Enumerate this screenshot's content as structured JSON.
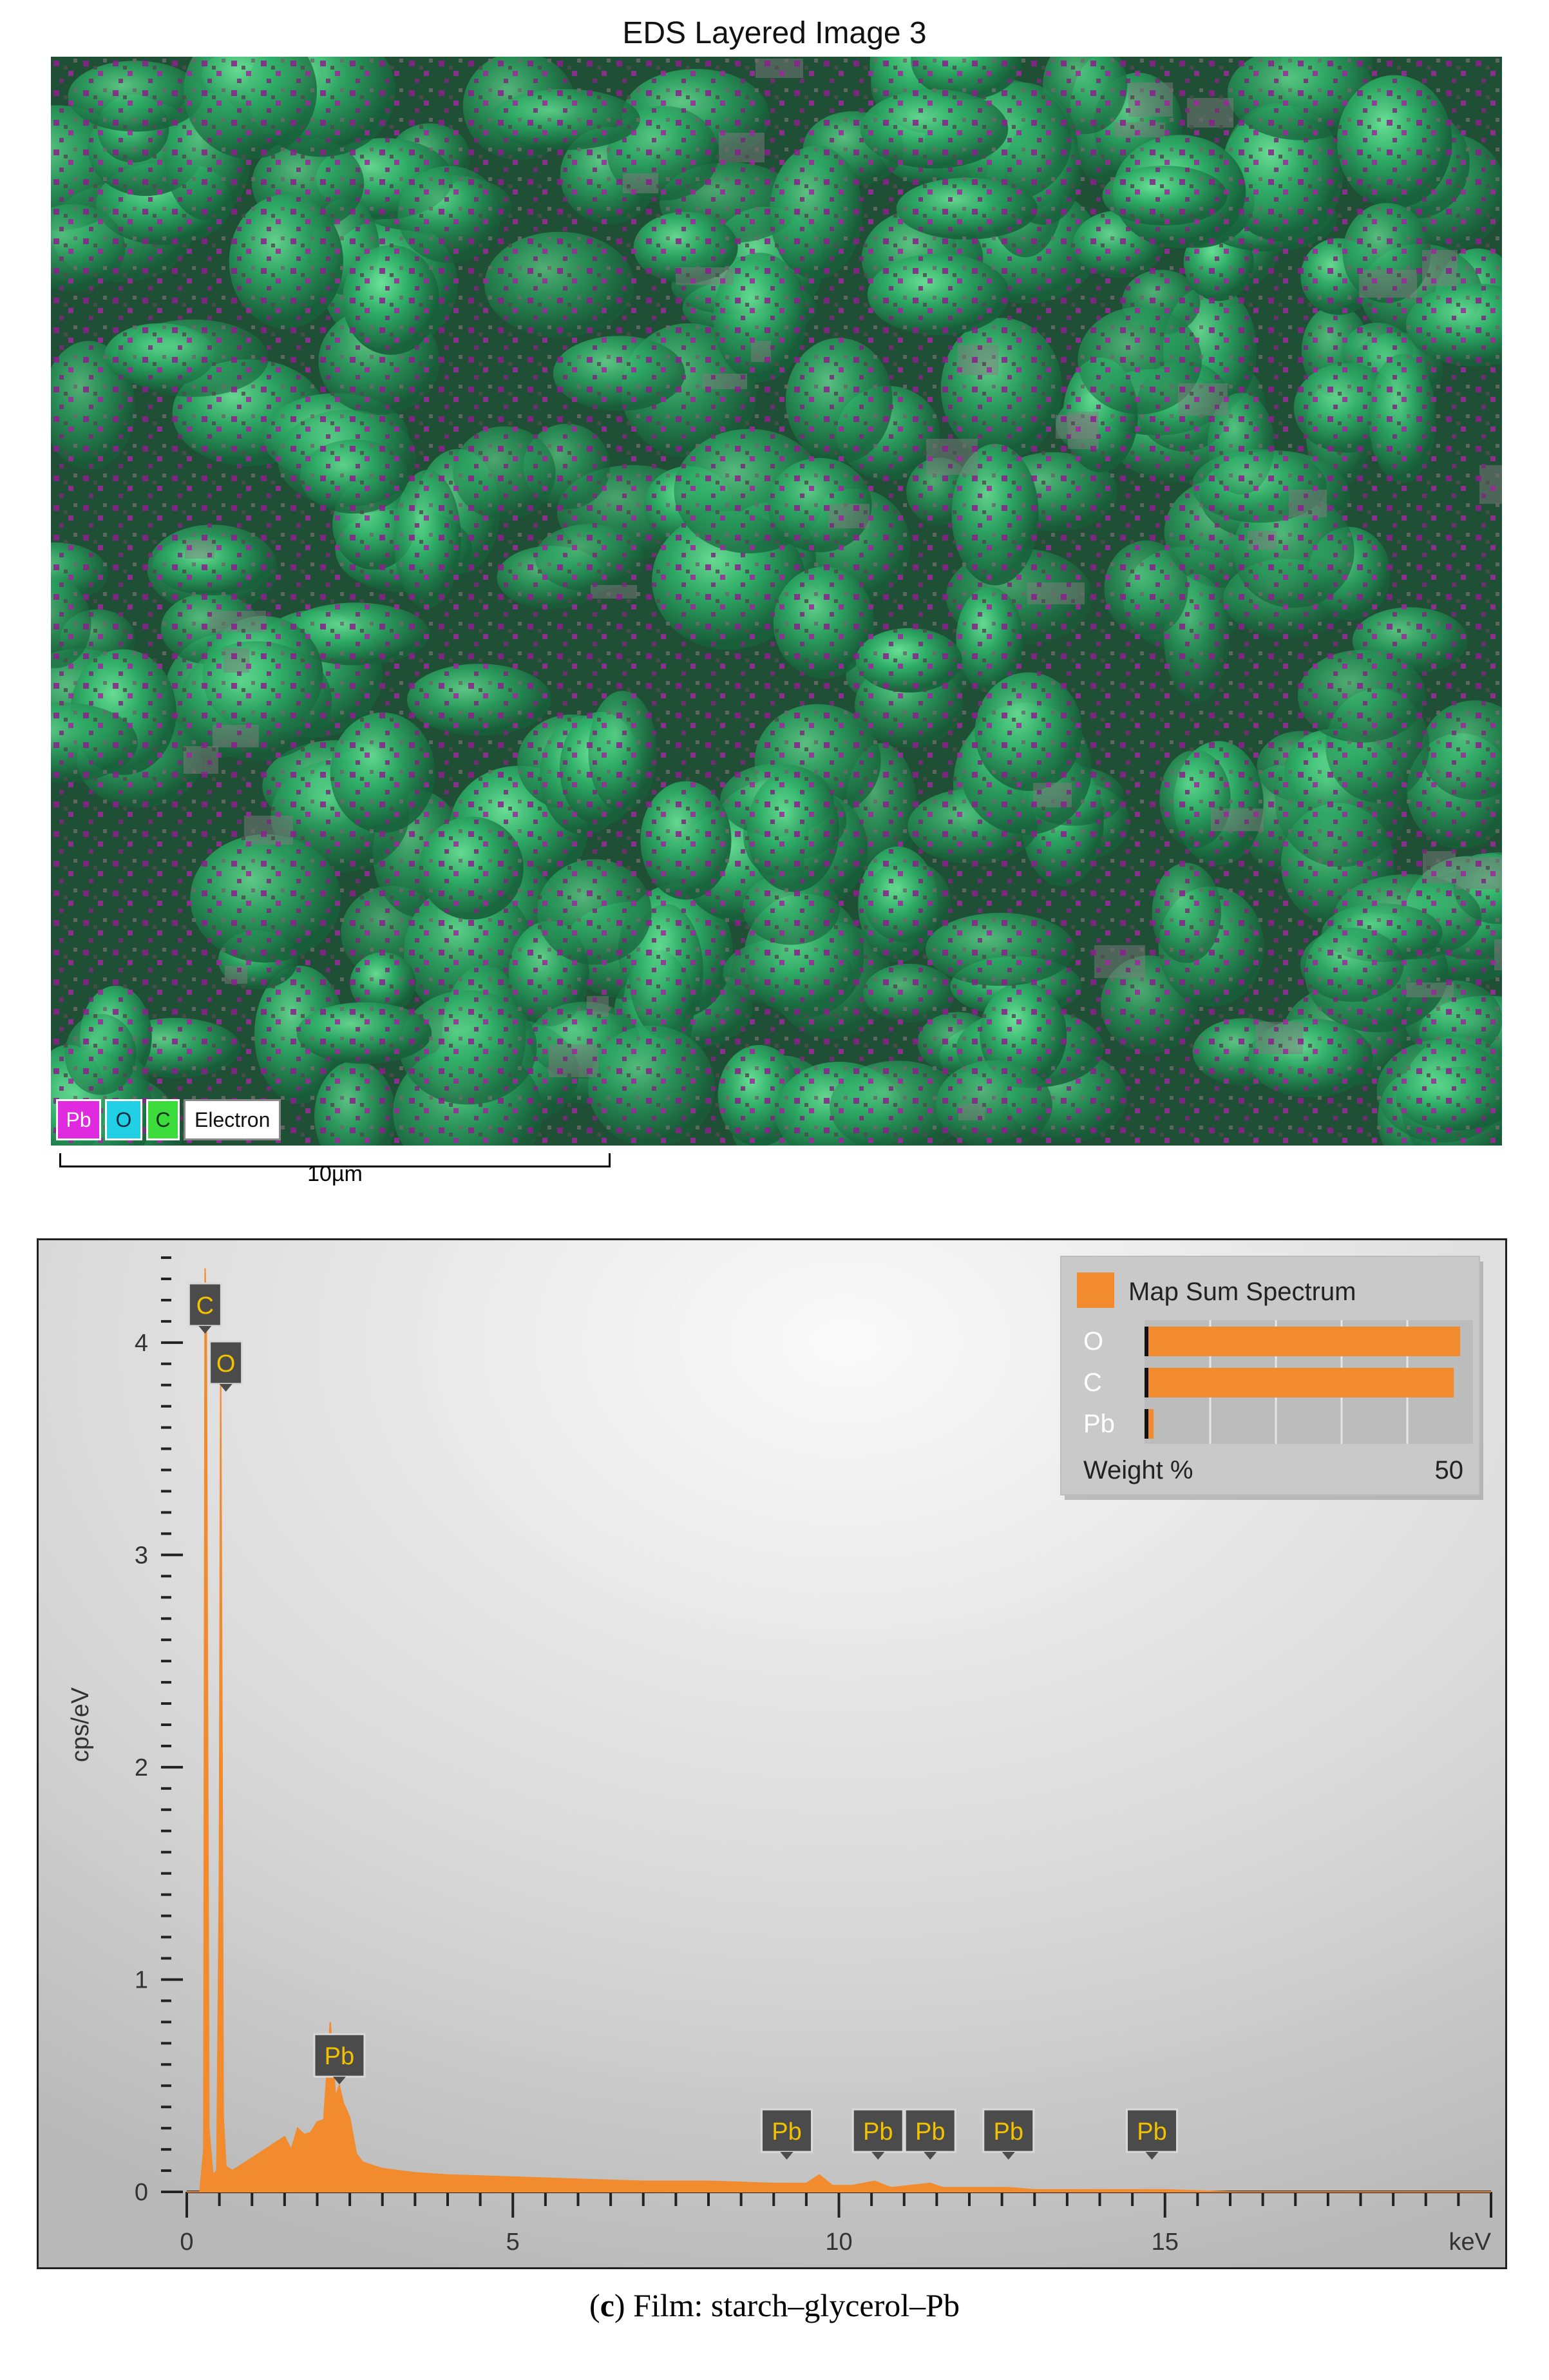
{
  "map": {
    "title": "EDS Layered Image 3",
    "legend": [
      {
        "label": "Pb",
        "color": "#e02ae0"
      },
      {
        "label": "O",
        "color": "#22d0e6"
      },
      {
        "label": "C",
        "color": "#3cdc3c"
      },
      {
        "label": "Electron",
        "color": "#ffffff"
      }
    ],
    "scalebar_label": "10µm"
  },
  "chart_data": {
    "type": "area",
    "title": "",
    "xlabel": "keV",
    "ylabel": "cps/eV",
    "xlim": [
      0,
      20
    ],
    "ylim": [
      0,
      4.4
    ],
    "xticks": [
      0,
      5,
      10,
      15
    ],
    "yticks": [
      0,
      1,
      2,
      3,
      4
    ],
    "series": [
      {
        "name": "Map Sum Spectrum",
        "color": "#f28a2e",
        "x": [
          0.0,
          0.2,
          0.26,
          0.28,
          0.3,
          0.34,
          0.4,
          0.46,
          0.5,
          0.52,
          0.54,
          0.56,
          0.6,
          0.7,
          0.9,
          1.1,
          1.3,
          1.5,
          1.6,
          1.7,
          1.8,
          1.9,
          2.0,
          2.1,
          2.2,
          2.28,
          2.34,
          2.4,
          2.5,
          2.6,
          2.7,
          3.0,
          3.5,
          4.0,
          5.0,
          6.0,
          7.0,
          8.0,
          9.0,
          9.5,
          9.7,
          9.9,
          10.2,
          10.55,
          10.8,
          11.4,
          11.6,
          12.0,
          12.6,
          13.0,
          14.0,
          15.0,
          16.0,
          17.0,
          18.0,
          19.0,
          20.0
        ],
        "y": [
          0,
          0,
          0.2,
          4.35,
          4.1,
          0.3,
          0.08,
          0.1,
          1.5,
          3.9,
          2.2,
          0.35,
          0.12,
          0.1,
          0.14,
          0.18,
          0.22,
          0.26,
          0.2,
          0.3,
          0.27,
          0.28,
          0.33,
          0.34,
          0.8,
          0.45,
          0.5,
          0.42,
          0.35,
          0.18,
          0.14,
          0.11,
          0.09,
          0.08,
          0.07,
          0.06,
          0.05,
          0.05,
          0.04,
          0.04,
          0.08,
          0.03,
          0.03,
          0.05,
          0.02,
          0.04,
          0.02,
          0.02,
          0.02,
          0.01,
          0.01,
          0.01,
          0.0,
          0.0,
          0.0,
          0.0,
          0.0
        ]
      }
    ],
    "peak_labels": [
      {
        "label": "C",
        "x": 0.28,
        "y": 4.35
      },
      {
        "label": "O",
        "x": 0.52,
        "y": 3.9
      },
      {
        "label": "Pb",
        "x": 2.34,
        "y": 0.5
      },
      {
        "label": "Pb",
        "x": 9.2,
        "y": 0.05
      },
      {
        "label": "Pb",
        "x": 10.6,
        "y": 0.05
      },
      {
        "label": "Pb",
        "x": 11.4,
        "y": 0.05
      },
      {
        "label": "Pb",
        "x": 12.6,
        "y": 0.04
      },
      {
        "label": "Pb",
        "x": 14.8,
        "y": 0.04
      }
    ],
    "weight_inset": {
      "title": "Map Sum Spectrum",
      "axis_label": "Weight %",
      "max_label": "50",
      "max": 50,
      "bars": [
        {
          "element": "O",
          "value": 50
        },
        {
          "element": "C",
          "value": 49
        },
        {
          "element": "Pb",
          "value": 1
        }
      ]
    }
  },
  "caption": {
    "letter": "c",
    "text": " Film: starch–glycerol–Pb"
  }
}
